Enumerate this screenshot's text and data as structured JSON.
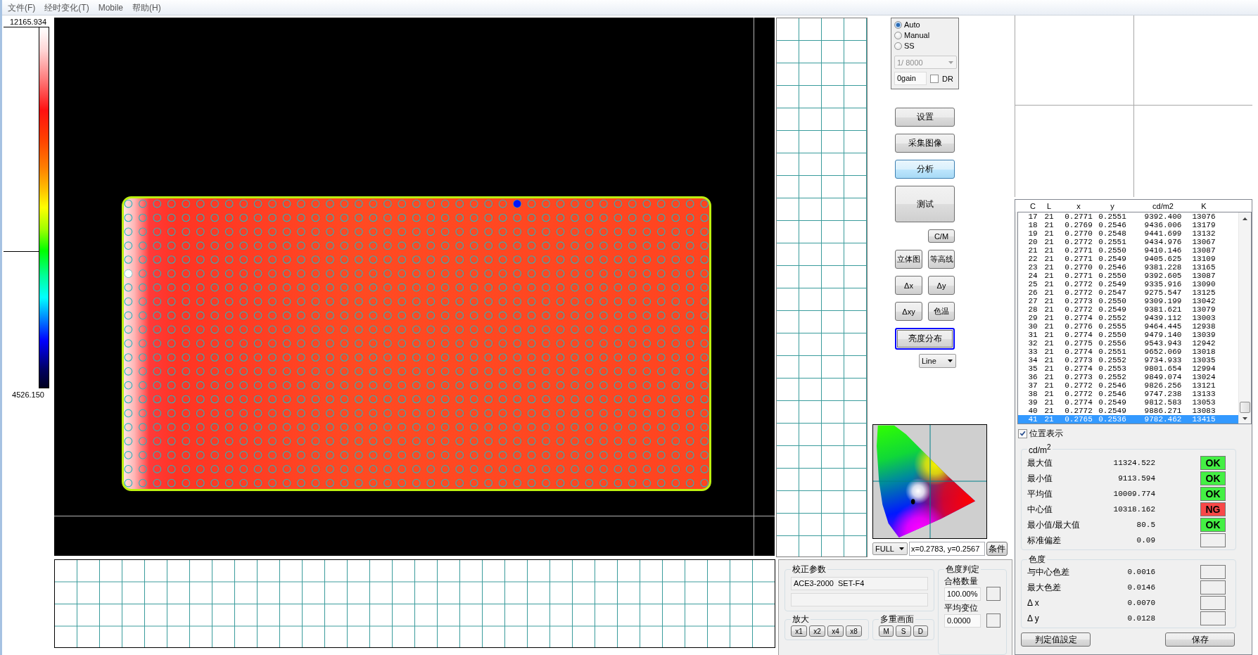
{
  "menu_bar": {
    "items": [
      "文件(F)",
      "经时变化(T)",
      "Mobile",
      "帮助(H)"
    ]
  },
  "color_scale": {
    "max": "12165.934",
    "min": "4526.150",
    "level": 0.38
  },
  "exposure": {
    "options": [
      {
        "label": "Auto",
        "selected": true
      },
      {
        "label": "Manual",
        "selected": false
      },
      {
        "label": "SS",
        "selected": false
      }
    ],
    "shutter": {
      "value": "1/ 8000",
      "disabled": true
    },
    "gain": {
      "value": "0gain"
    },
    "dr": {
      "label": "DR",
      "checked": false
    }
  },
  "tool_buttons": [
    {
      "label": "设置",
      "kind": "wide",
      "highlighted": false,
      "focused": false
    },
    {
      "label": "采集图像",
      "kind": "wide",
      "highlighted": false,
      "focused": false
    },
    {
      "label": "分析",
      "kind": "wide",
      "highlighted": true,
      "focused": false
    },
    {
      "label": "测试",
      "kind": "tall",
      "highlighted": false,
      "focused": false
    },
    {
      "label": "C/M",
      "kind": "small",
      "highlighted": false,
      "focused": false
    },
    {
      "label": "立体图",
      "kind": "half",
      "highlighted": false,
      "focused": false
    },
    {
      "label": "等高线",
      "kind": "half",
      "highlighted": false,
      "focused": false
    },
    {
      "label": "Δx",
      "kind": "half",
      "highlighted": false,
      "focused": false
    },
    {
      "label": "Δy",
      "kind": "half",
      "highlighted": false,
      "focused": false
    },
    {
      "label": "Δxy",
      "kind": "half",
      "highlighted": false,
      "focused": false
    },
    {
      "label": "色温",
      "kind": "half",
      "highlighted": false,
      "focused": false
    },
    {
      "label": "亮度分布",
      "kind": "wide",
      "highlighted": false,
      "focused": true
    }
  ],
  "line_mode": {
    "value": "Line"
  },
  "chromaticity": {
    "range": "FULL",
    "readout": "x=0.2783, y=0.2567",
    "button": "条件"
  },
  "table": {
    "columns": [
      "C",
      "L",
      "x",
      "y",
      "cd/m2",
      "K"
    ],
    "rows": [
      {
        "cells": [
          "17",
          "21",
          "0.2771",
          "0.2551",
          "9392.400",
          "13076"
        ],
        "selected": false
      },
      {
        "cells": [
          "18",
          "21",
          "0.2769",
          "0.2546",
          "9436.006",
          "13179"
        ],
        "selected": false
      },
      {
        "cells": [
          "19",
          "21",
          "0.2770",
          "0.2548",
          "9441.699",
          "13132"
        ],
        "selected": false
      },
      {
        "cells": [
          "20",
          "21",
          "0.2772",
          "0.2551",
          "9434.976",
          "13067"
        ],
        "selected": false
      },
      {
        "cells": [
          "21",
          "21",
          "0.2771",
          "0.2550",
          "9410.146",
          "13087"
        ],
        "selected": false
      },
      {
        "cells": [
          "22",
          "21",
          "0.2771",
          "0.2549",
          "9405.625",
          "13109"
        ],
        "selected": false
      },
      {
        "cells": [
          "23",
          "21",
          "0.2770",
          "0.2546",
          "9381.228",
          "13165"
        ],
        "selected": false
      },
      {
        "cells": [
          "24",
          "21",
          "0.2771",
          "0.2550",
          "9392.605",
          "13087"
        ],
        "selected": false
      },
      {
        "cells": [
          "25",
          "21",
          "0.2772",
          "0.2549",
          "9335.916",
          "13090"
        ],
        "selected": false
      },
      {
        "cells": [
          "26",
          "21",
          "0.2772",
          "0.2547",
          "9275.547",
          "13125"
        ],
        "selected": false
      },
      {
        "cells": [
          "27",
          "21",
          "0.2773",
          "0.2550",
          "9309.199",
          "13042"
        ],
        "selected": false
      },
      {
        "cells": [
          "28",
          "21",
          "0.2772",
          "0.2549",
          "9381.621",
          "13079"
        ],
        "selected": false
      },
      {
        "cells": [
          "29",
          "21",
          "0.2774",
          "0.2552",
          "9439.112",
          "13003"
        ],
        "selected": false
      },
      {
        "cells": [
          "30",
          "21",
          "0.2776",
          "0.2555",
          "9464.445",
          "12938"
        ],
        "selected": false
      },
      {
        "cells": [
          "31",
          "21",
          "0.2774",
          "0.2550",
          "9479.140",
          "13039"
        ],
        "selected": false
      },
      {
        "cells": [
          "32",
          "21",
          "0.2775",
          "0.2556",
          "9543.943",
          "12942"
        ],
        "selected": false
      },
      {
        "cells": [
          "33",
          "21",
          "0.2774",
          "0.2551",
          "9652.069",
          "13018"
        ],
        "selected": false
      },
      {
        "cells": [
          "34",
          "21",
          "0.2773",
          "0.2552",
          "9734.933",
          "13035"
        ],
        "selected": false
      },
      {
        "cells": [
          "35",
          "21",
          "0.2774",
          "0.2553",
          "9801.654",
          "12994"
        ],
        "selected": false
      },
      {
        "cells": [
          "36",
          "21",
          "0.2773",
          "0.2552",
          "9849.074",
          "13024"
        ],
        "selected": false
      },
      {
        "cells": [
          "37",
          "21",
          "0.2772",
          "0.2546",
          "9826.256",
          "13121"
        ],
        "selected": false
      },
      {
        "cells": [
          "38",
          "21",
          "0.2772",
          "0.2546",
          "9747.238",
          "13133"
        ],
        "selected": false
      },
      {
        "cells": [
          "39",
          "21",
          "0.2774",
          "0.2549",
          "9812.583",
          "13053"
        ],
        "selected": false
      },
      {
        "cells": [
          "40",
          "21",
          "0.2772",
          "0.2549",
          "9886.271",
          "13083"
        ],
        "selected": false
      },
      {
        "cells": [
          "41",
          "21",
          "0.2765",
          "0.2536",
          "9782.462",
          "13415"
        ],
        "selected": true
      }
    ]
  },
  "position_display": {
    "label": "位置表示",
    "checked": true
  },
  "luminance": {
    "title": "cd/m$^{2}$",
    "rows": [
      {
        "label": "最大值",
        "value": "11324.522",
        "result": "OK",
        "color": "#44f044"
      },
      {
        "label": "最小值",
        "value": "9113.594",
        "result": "OK",
        "color": "#44f044"
      },
      {
        "label": "平均值",
        "value": "10009.774",
        "result": "OK",
        "color": "#44f044"
      },
      {
        "label": "中心值",
        "value": "10318.162",
        "result": "NG",
        "color": "#f84848"
      },
      {
        "label": "最小值/最大值",
        "value": "80.5",
        "result": "OK",
        "color": "#44f044"
      },
      {
        "label": "标准偏差",
        "value": "0.09"
      }
    ]
  },
  "chroma_stats": {
    "title": "色度",
    "rows": [
      {
        "label": "与中心色差",
        "value": "0.0016"
      },
      {
        "label": "最大色差",
        "value": "0.0146"
      },
      {
        "label": "Δ x",
        "value": "0.0070"
      },
      {
        "label": "Δ y",
        "value": "0.0128"
      }
    ]
  },
  "footer_buttons": [
    "判定值設定",
    "保存"
  ],
  "calibration": {
    "title": "校正参数",
    "value": "ACE3-2000  SET-F4"
  },
  "chroma_judgment": {
    "title": "色度判定",
    "items": [
      {
        "label": "合格数量",
        "value": "100.00%"
      },
      {
        "label": "平均变位",
        "value": "0.0000"
      }
    ]
  },
  "magnify": {
    "title": "放大",
    "buttons": [
      "x1",
      "x2",
      "x4",
      "x8"
    ]
  },
  "multi_view": {
    "title": "多重画面",
    "buttons": [
      "M",
      "S",
      "D"
    ]
  }
}
